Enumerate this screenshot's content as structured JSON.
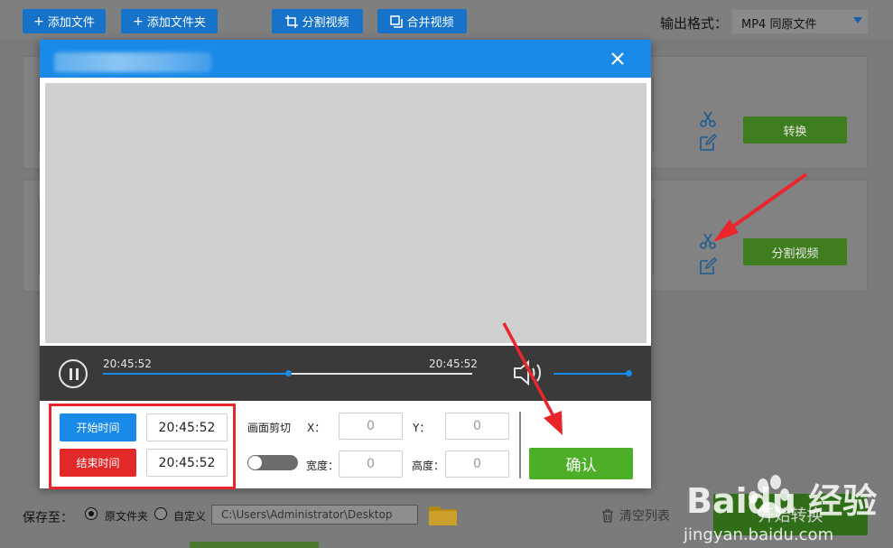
{
  "toolbar": {
    "add_file": "添加文件",
    "add_folder": "添加文件夹",
    "split_video": "分割视频",
    "merge_video": "合并视频",
    "output_format_label": "输出格式：",
    "output_format_value": "MP4  同原文件"
  },
  "file_rows": [
    {
      "action_label": "转换"
    },
    {
      "action_label": "分割视频"
    }
  ],
  "modal": {
    "player": {
      "current_time": "20:45:52",
      "end_time": "20:45:52",
      "progress": 0.5,
      "volume": 1.0
    },
    "trim": {
      "start_button": "开始时间",
      "end_button": "结束时间",
      "start_value": "20:45:52",
      "end_value": "20:45:52"
    },
    "crop": {
      "label": "画面剪切",
      "x_label": "X：",
      "x_value": "0",
      "y_label": "Y：",
      "y_value": "0",
      "width_label": "宽度：",
      "width_value": "0",
      "height_label": "高度：",
      "height_value": "0"
    },
    "confirm_label": "确认"
  },
  "footer": {
    "save_to_label": "保存至：",
    "option_original": "原文件夹",
    "option_custom": "自定义",
    "path_value": "C:\\Users\\Administrator\\Desktop",
    "clear_list": "清空列表",
    "start_convert": "开始转换"
  },
  "watermark": {
    "brand": "Baidu 经验",
    "site": "jingyan.baidu.com"
  },
  "colors": {
    "accent_blue": "#1a8ae8",
    "confirm_green": "#4caf27",
    "end_time_red": "#e22828",
    "annotation_red": "#e8262c"
  }
}
